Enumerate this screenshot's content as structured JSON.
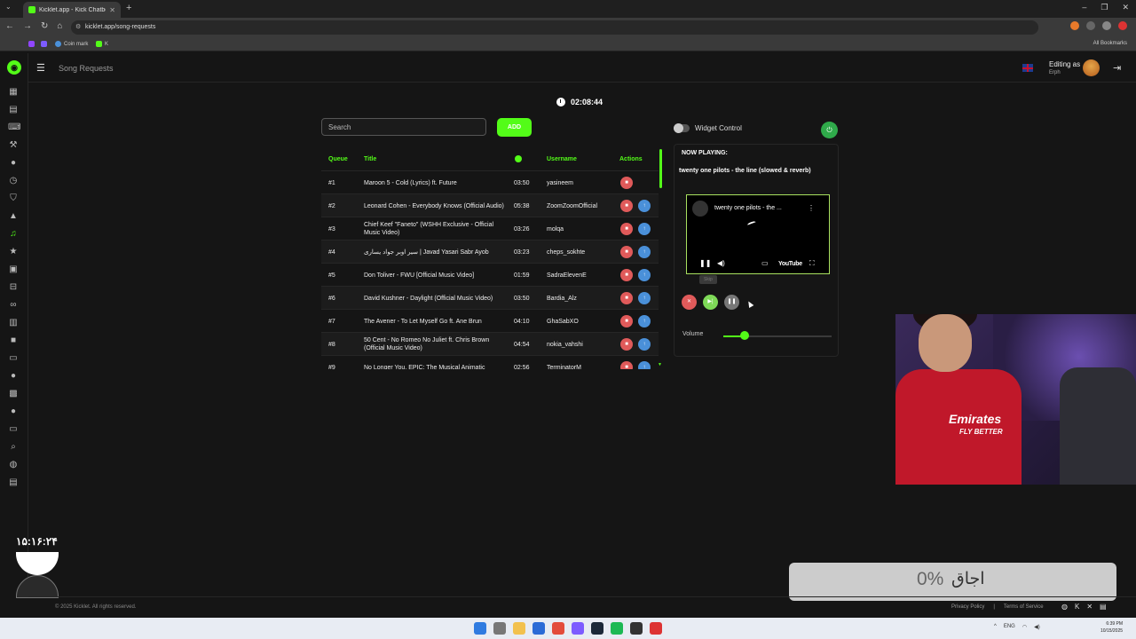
{
  "browser": {
    "tab_title": "Kicklet.app - Kick Chatbot and",
    "url": "kicklet.app/song-requests",
    "bookmarks": [
      "Coin mark",
      "K"
    ],
    "all_bookmarks": "All Bookmarks"
  },
  "header": {
    "page_title": "Song Requests",
    "editing_label": "Editing as",
    "editing_user": "Erph"
  },
  "timer": "02:08:44",
  "search": {
    "placeholder": "Search"
  },
  "add_label": "ADD",
  "queue": {
    "headers": {
      "queue": "Queue",
      "title": "Title",
      "username": "Username",
      "actions": "Actions"
    },
    "rows": [
      {
        "pos": "#1",
        "title": "Maroon 5 - Cold (Lyrics) ft. Future",
        "duration": "03:50",
        "username": "yasineem"
      },
      {
        "pos": "#2",
        "title": "Leonard Cohen - Everybody Knows (Official Audio)",
        "duration": "05:38",
        "username": "ZoomZoomOfficial"
      },
      {
        "pos": "#3",
        "title": "Chief Keef \"Faneto\" (WSHH Exclusive - Official Music Video)",
        "duration": "03:26",
        "username": "molqa"
      },
      {
        "pos": "#4",
        "title": "سیر اوبر جواد یساری | Javad Yasari Sabr Ayob",
        "duration": "03:23",
        "username": "cheps_sokhte"
      },
      {
        "pos": "#5",
        "title": "Don Toliver - FWU [Official Music Video]",
        "duration": "01:59",
        "username": "SadraElevenE"
      },
      {
        "pos": "#6",
        "title": "David Kushner - Daylight (Official Music Video)",
        "duration": "03:50",
        "username": "Bardia_Alz"
      },
      {
        "pos": "#7",
        "title": "The Avener - To Let Myself Go ft. Ane Brun",
        "duration": "04:10",
        "username": "GhaSabXO"
      },
      {
        "pos": "#8",
        "title": "50 Cent - No Romeo No Juliet ft. Chris Brown (Official Music Video)",
        "duration": "04:54",
        "username": "nokia_vahshi"
      },
      {
        "pos": "#9",
        "title": "No Longer You, EPIC: The Musical Animatic",
        "duration": "02:56",
        "username": "TerminatorM"
      }
    ]
  },
  "widget_control": "Widget Control",
  "now_playing": {
    "label": "NOW PLAYING:",
    "title": "twenty one pilots - the line (slowed & reverb)",
    "video_title": "twenty one pilots - the ...",
    "youtube_label": "YouTube",
    "skip_tooltip": "Skip",
    "volume_label": "Volume",
    "volume": 0.2
  },
  "overlay": {
    "clock": "۱۵:۱۶:۲۴",
    "progress_label": "اجاق",
    "progress_value": "0%"
  },
  "footer": {
    "copyright": "© 2025 Kicklet. All rights reserved.",
    "privacy": "Privacy Policy",
    "terms": "Terms of Service"
  },
  "taskbar": {
    "lang": "ENG",
    "time": "6:39 PM",
    "date": "10/15/2025"
  },
  "colors": {
    "accent": "#53fc18",
    "danger": "#e05a5a",
    "info": "#4a90d9"
  }
}
